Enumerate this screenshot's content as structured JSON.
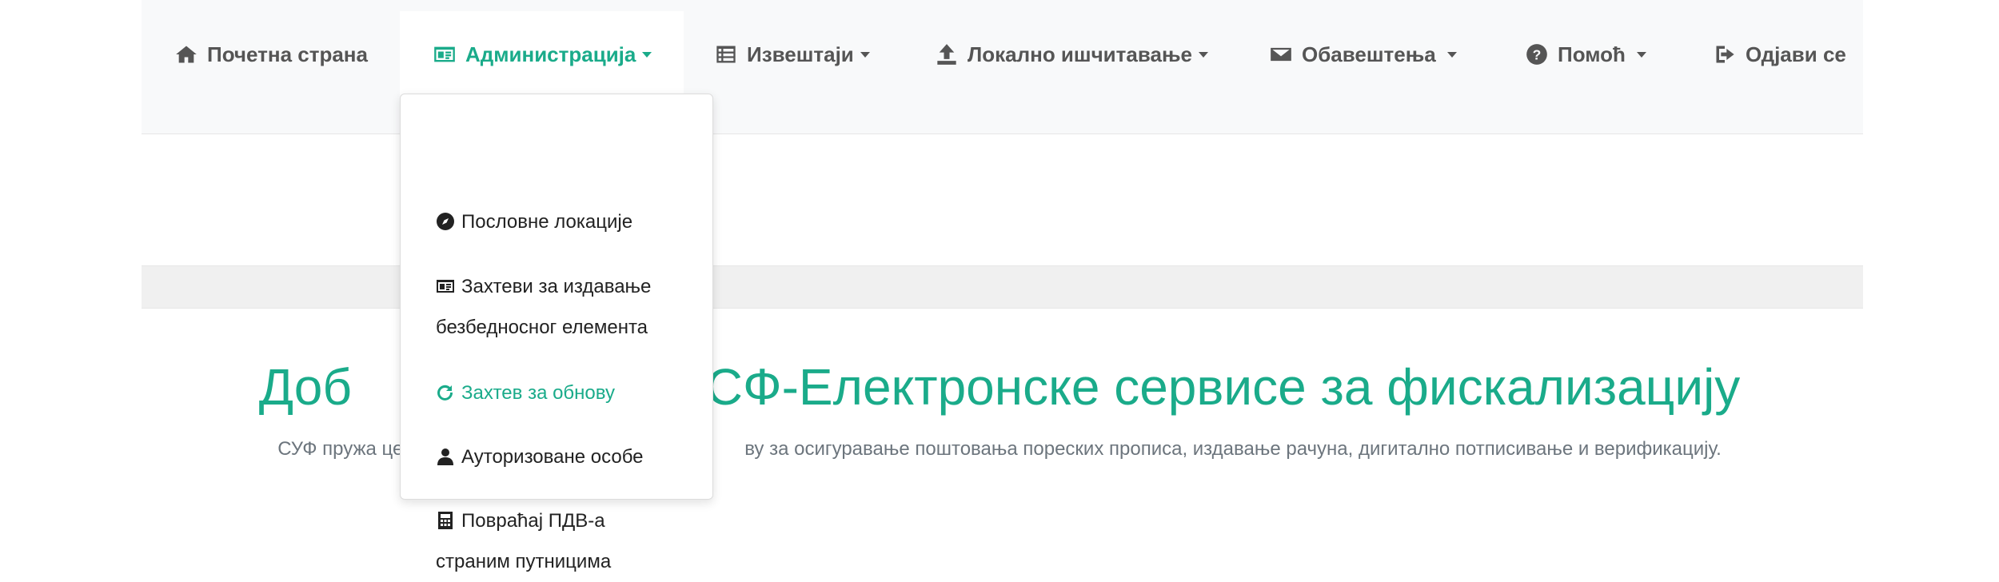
{
  "colors": {
    "accent": "#1aab8a",
    "navbar_bg": "#f8f9fa",
    "text": "#555555"
  },
  "nav": {
    "home": {
      "label": "Почетна страна",
      "icon": "home-icon"
    },
    "admin": {
      "label": "Администрација",
      "icon": "id-card-icon",
      "active": true
    },
    "reports": {
      "label": "Извештаји",
      "icon": "list-icon"
    },
    "upload": {
      "label": "Локално ишчитавање",
      "icon": "upload-icon"
    },
    "notifications": {
      "label": "Обавештења",
      "icon": "envelope-icon"
    },
    "help": {
      "label": "Помоћ",
      "icon": "question-circle-icon"
    },
    "logout": {
      "label": "Одјави се",
      "icon": "sign-out-icon"
    }
  },
  "dropdown": {
    "items": [
      {
        "label": "Пословне локације",
        "icon": "compass-icon"
      },
      {
        "label": "Захтеви за издавање безбедносног елемента",
        "icon": "id-card-icon"
      },
      {
        "label": "Захтев за обнову",
        "icon": "redo-icon",
        "active": true
      },
      {
        "label": "Ауторизоване особе",
        "icon": "user-icon"
      },
      {
        "label": "Повраћај ПДВ-а страним путницима",
        "icon": "calculator-icon"
      }
    ]
  },
  "main": {
    "welcome_left": "Доб",
    "welcome_right": "ЕСФ-Електронске сервисе за фискализацију",
    "sub_left": "СУФ пружа цело",
    "sub_right": "ву за осигуравање поштовања пореских прописа, издавање рачуна, дигитално потписивање и верификацију."
  }
}
